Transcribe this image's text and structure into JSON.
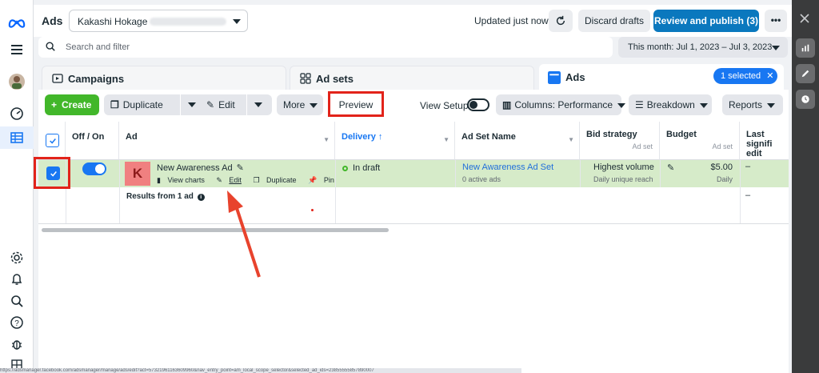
{
  "topbar": {
    "title": "Ads",
    "account_name": "Kakashi Hokage",
    "updated_text": "Updated just now",
    "discard_label": "Discard drafts",
    "publish_label": "Review and publish (3)",
    "more_label": "•••"
  },
  "search": {
    "placeholder": "Search and filter"
  },
  "date_range": "This month: Jul 1, 2023 – Jul 3, 2023",
  "tabs": [
    {
      "label": "Campaigns"
    },
    {
      "label": "Ad sets"
    },
    {
      "label": "Ads"
    }
  ],
  "selected_pill": "1 selected",
  "toolbar": {
    "create": "Create",
    "duplicate": "Duplicate",
    "edit": "Edit",
    "more": "More",
    "preview": "Preview",
    "view_setup": "View Setup",
    "columns": "Columns: Performance",
    "breakdown": "Breakdown",
    "reports": "Reports"
  },
  "table": {
    "headers": {
      "off_on": "Off / On",
      "ad": "Ad",
      "delivery": "Delivery ↑",
      "ad_set_name": "Ad Set Name",
      "bid_strategy": "Bid strategy",
      "bid_strategy_sub": "Ad set",
      "budget": "Budget",
      "budget_sub": "Ad set",
      "last_edit": "Last signifi edit"
    },
    "row": {
      "thumb_letter": "K",
      "ad_name": "New Awareness Ad",
      "link_view_charts": "View charts",
      "link_edit": "Edit",
      "link_duplicate": "Duplicate",
      "link_pin": "Pin",
      "delivery": "In draft",
      "ad_set_name": "New Awareness Ad Set",
      "ad_set_sub": "0 active ads",
      "bid_strategy": "Highest volume",
      "bid_strategy_sub": "Daily unique reach",
      "budget": "$5.00",
      "budget_sub": "Daily",
      "last_edit": "–"
    },
    "results_label": "Results from 1 ad",
    "results_last_edit": "–"
  },
  "status_url": "https://adsmanager.facebook.com/adsmanager/manage/ads/edit?act=57321961163609960&nav_entry_point=am_local_scope_selector&selected_ad_ids=23855555857890007"
}
